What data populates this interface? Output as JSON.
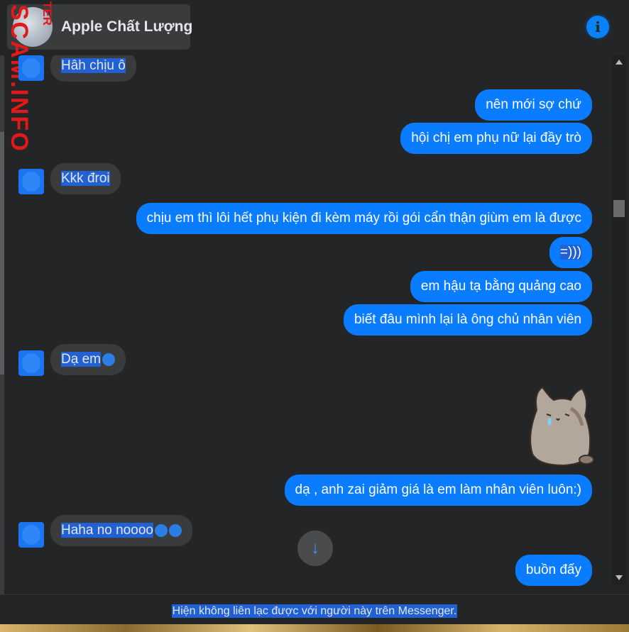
{
  "header": {
    "title": "Apple Chất Lượng",
    "info_icon": "info-icon",
    "watermark_small": "TER",
    "watermark_large": "SCAM.INFO"
  },
  "messages": [
    {
      "id": "m1",
      "dir": "in",
      "text": "Hâh chịu ô"
    },
    {
      "id": "m2",
      "dir": "out",
      "text": "nên mới sợ chứ"
    },
    {
      "id": "m3",
      "dir": "out",
      "text": "hội chị em phụ nữ lại đầy trò"
    },
    {
      "id": "m4",
      "dir": "in",
      "text": "Kkk đroi"
    },
    {
      "id": "m5",
      "dir": "out",
      "text": "chịu em thì lôi hết phụ kiện đi kèm máy rồi gói cẩn thận giùm em là được"
    },
    {
      "id": "m6",
      "dir": "out",
      "text": "=)))"
    },
    {
      "id": "m7",
      "dir": "out",
      "text": "em hậu tạ bằng quảng cao"
    },
    {
      "id": "m8",
      "dir": "out",
      "text": "biết đâu mình lại là ông chủ nhân viên"
    },
    {
      "id": "m9",
      "dir": "in",
      "text": "Dạ em"
    },
    {
      "id": "m10",
      "dir": "out",
      "text": "dạ , anh zai giảm giá là em làm nhân viên luôn:)"
    },
    {
      "id": "m11",
      "dir": "in",
      "text": "Haha no noooo"
    },
    {
      "id": "m12",
      "dir": "out",
      "text": "buồn đấy"
    }
  ],
  "sticker": {
    "icon": "crying-cat-sticker-icon"
  },
  "scroll_down": {
    "icon": "arrow-down-icon",
    "glyph": "↓"
  },
  "footer": {
    "text": "Hiện không liên lạc được với người này trên Messenger."
  },
  "colors": {
    "outgoing": "#0a7cff",
    "incoming": "#3a3b3c",
    "background": "#242526",
    "selection": "#2161d4"
  }
}
